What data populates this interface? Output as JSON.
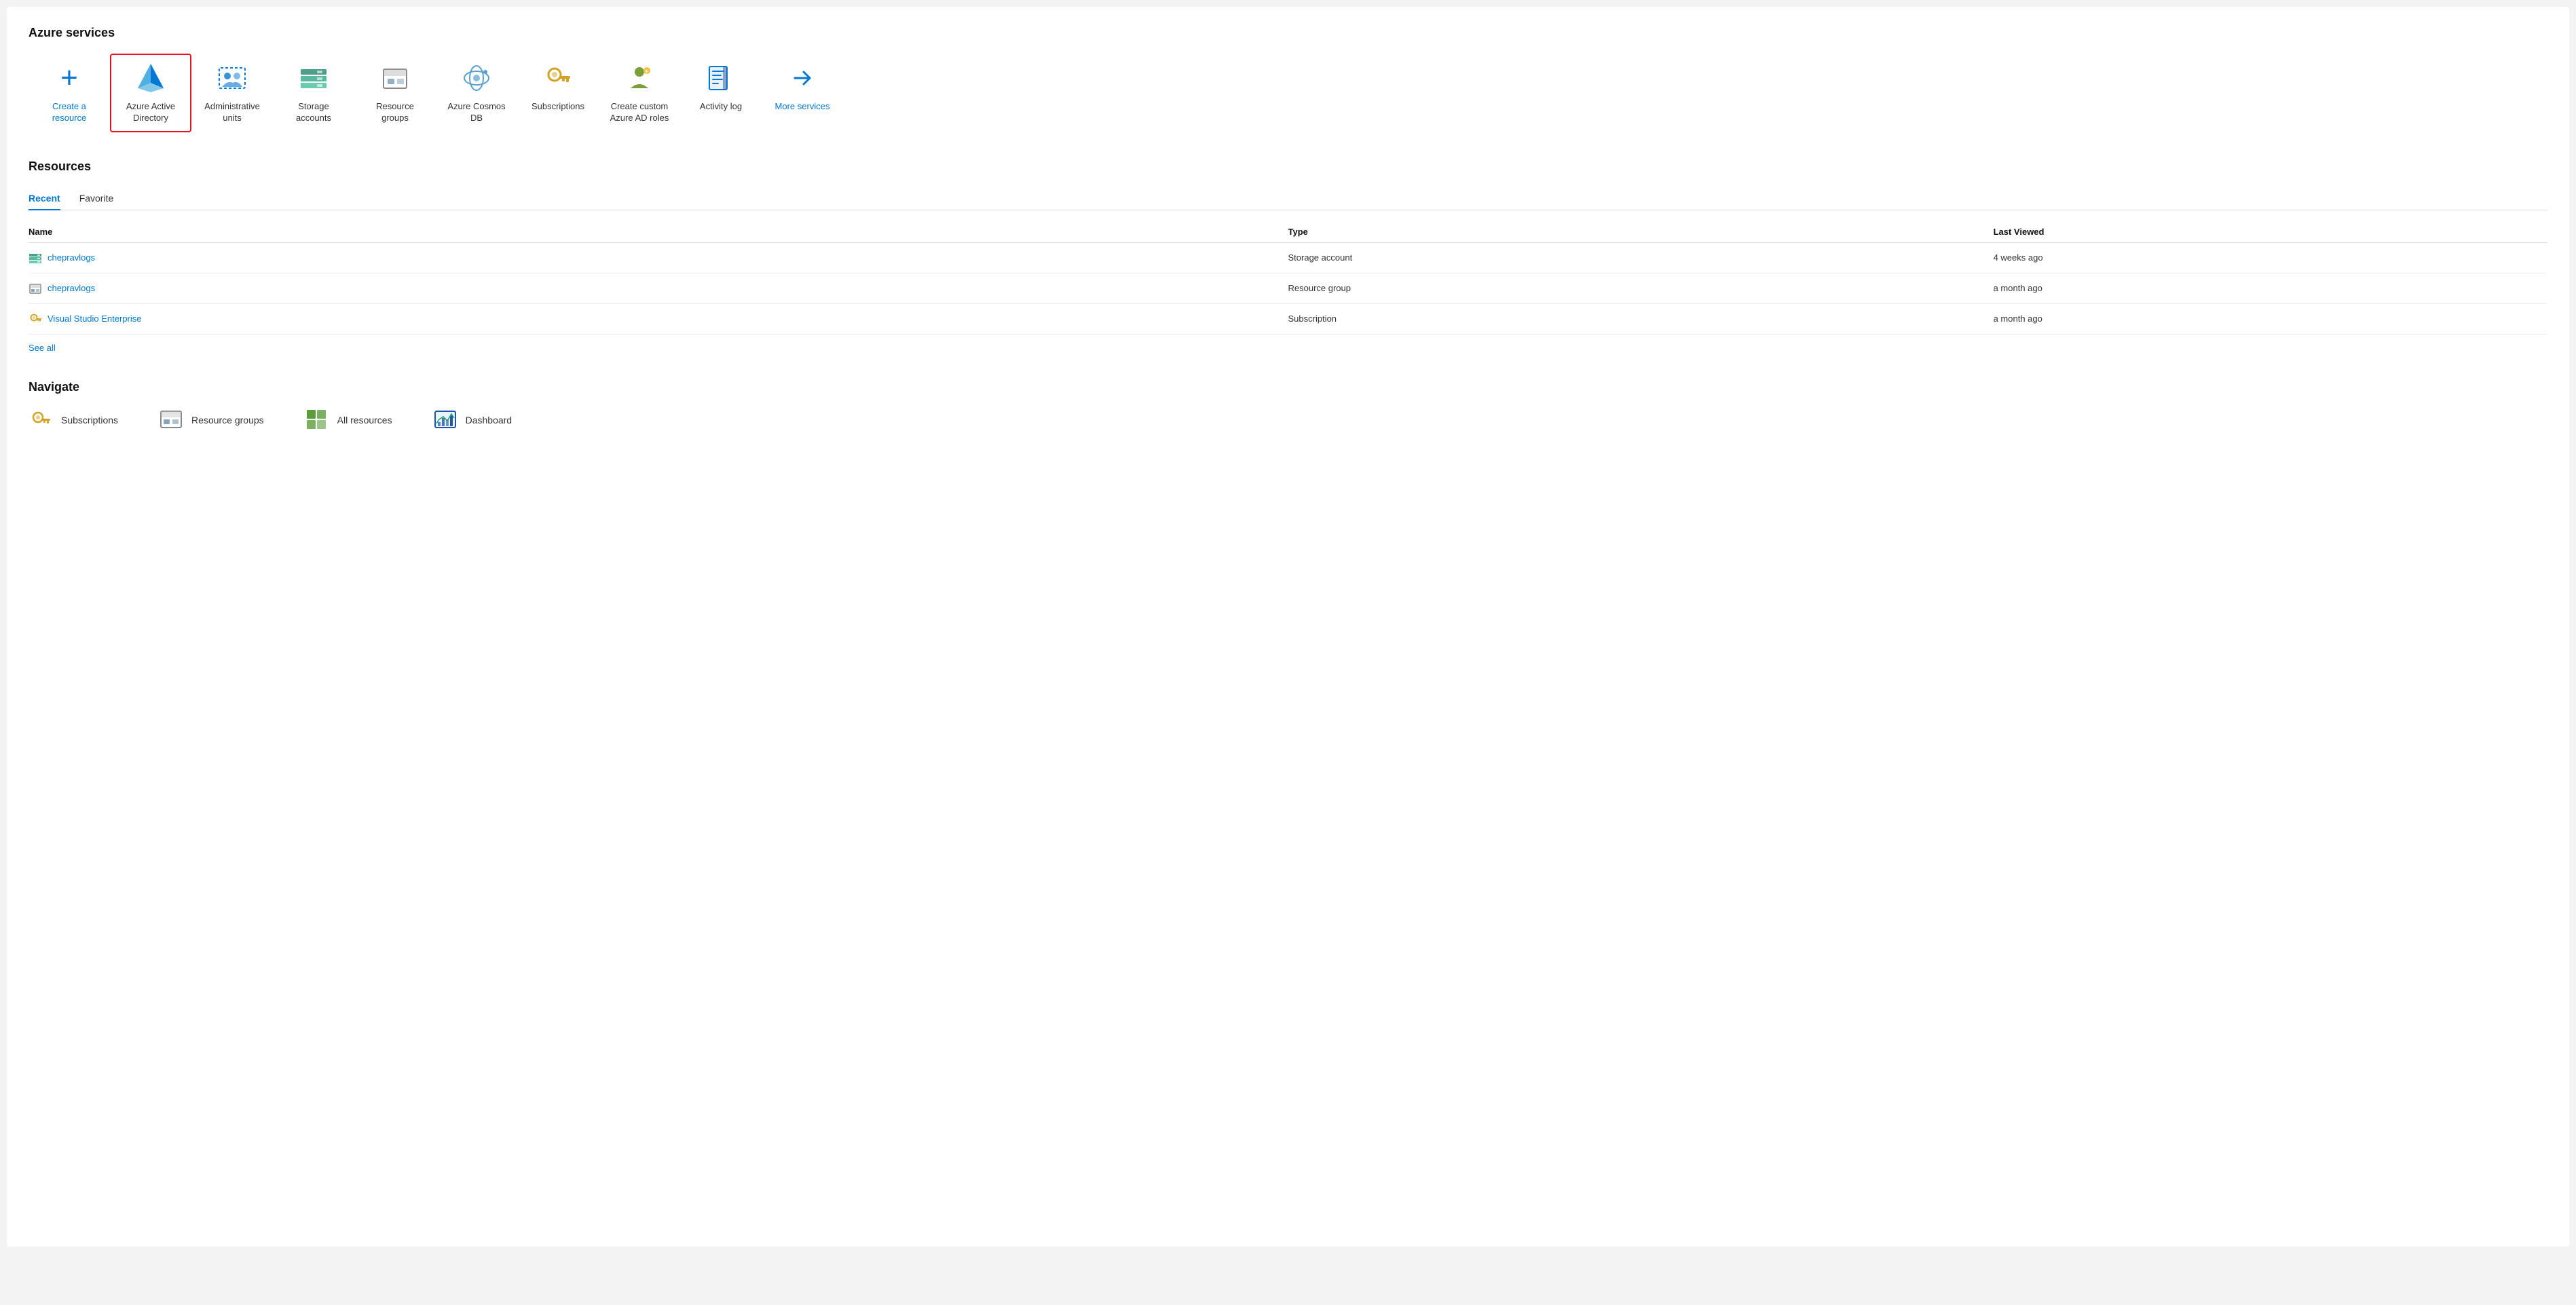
{
  "page": {
    "sections": {
      "azure_services": {
        "title": "Azure services",
        "items": [
          {
            "id": "create-resource",
            "label": "Create a\nresource",
            "label_line1": "Create a",
            "label_line2": "resource",
            "icon_type": "plus",
            "selected": false,
            "blue_label": true
          },
          {
            "id": "azure-active-directory",
            "label": "Azure Active\nDirectory",
            "label_line1": "Azure Active",
            "label_line2": "Directory",
            "icon_type": "aad",
            "selected": true,
            "blue_label": false
          },
          {
            "id": "administrative-units",
            "label": "Administrative\nunits",
            "label_line1": "Administrative",
            "label_line2": "units",
            "icon_type": "admin-units",
            "selected": false,
            "blue_label": false
          },
          {
            "id": "storage-accounts",
            "label": "Storage\naccounts",
            "label_line1": "Storage",
            "label_line2": "accounts",
            "icon_type": "storage",
            "selected": false,
            "blue_label": false
          },
          {
            "id": "resource-groups",
            "label": "Resource\ngroups",
            "label_line1": "Resource",
            "label_line2": "groups",
            "icon_type": "resource-groups",
            "selected": false,
            "blue_label": false
          },
          {
            "id": "cosmos-db",
            "label": "Azure Cosmos\nDB",
            "label_line1": "Azure Cosmos",
            "label_line2": "DB",
            "icon_type": "cosmos",
            "selected": false,
            "blue_label": false
          },
          {
            "id": "subscriptions",
            "label": "Subscriptions",
            "label_line1": "Subscriptions",
            "label_line2": "",
            "icon_type": "key",
            "selected": false,
            "blue_label": false
          },
          {
            "id": "custom-ad-roles",
            "label": "Create custom\nAzure AD roles",
            "label_line1": "Create custom",
            "label_line2": "Azure AD roles",
            "icon_type": "custom-roles",
            "selected": false,
            "blue_label": false
          },
          {
            "id": "activity-log",
            "label": "Activity log",
            "label_line1": "Activity log",
            "label_line2": "",
            "icon_type": "activity-log",
            "selected": false,
            "blue_label": false
          },
          {
            "id": "more-services",
            "label": "More services",
            "label_line1": "More services",
            "label_line2": "",
            "icon_type": "arrow-right",
            "selected": false,
            "blue_label": true
          }
        ]
      },
      "resources": {
        "title": "Resources",
        "tabs": [
          {
            "id": "recent",
            "label": "Recent",
            "active": true
          },
          {
            "id": "favorite",
            "label": "Favorite",
            "active": false
          }
        ],
        "table": {
          "headers": {
            "name": "Name",
            "type": "Type",
            "last_viewed": "Last Viewed"
          },
          "rows": [
            {
              "name": "chepravlogs",
              "type": "Storage account",
              "last_viewed": "4 weeks ago",
              "icon_type": "storage"
            },
            {
              "name": "chepravlogs",
              "type": "Resource group",
              "last_viewed": "a month ago",
              "icon_type": "resource-groups"
            },
            {
              "name": "Visual Studio Enterprise",
              "type": "Subscription",
              "last_viewed": "a month ago",
              "icon_type": "key"
            }
          ]
        },
        "see_all_label": "See all"
      },
      "navigate": {
        "title": "Navigate",
        "items": [
          {
            "id": "subscriptions",
            "label": "Subscriptions",
            "icon_type": "key"
          },
          {
            "id": "resource-groups",
            "label": "Resource groups",
            "icon_type": "resource-groups"
          },
          {
            "id": "all-resources",
            "label": "All resources",
            "icon_type": "all-resources"
          },
          {
            "id": "dashboard",
            "label": "Dashboard",
            "icon_type": "dashboard"
          }
        ]
      }
    }
  }
}
